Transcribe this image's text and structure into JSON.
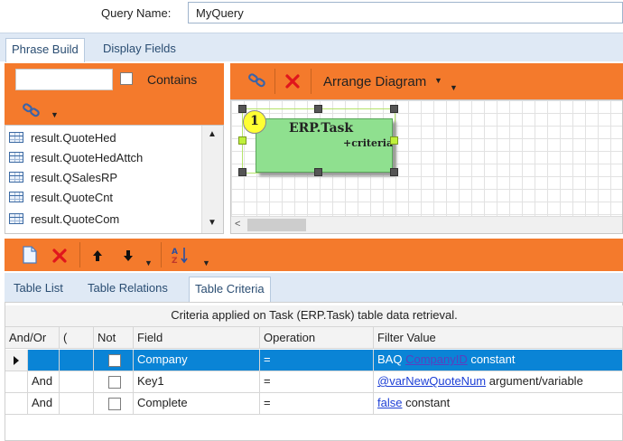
{
  "query": {
    "label": "Query Name:",
    "value": "MyQuery"
  },
  "top_tabs": [
    {
      "label": "Phrase Build",
      "active": true
    },
    {
      "label": "Display Fields",
      "active": false
    }
  ],
  "table_search": {
    "placeholder": "",
    "contains_label": "Contains"
  },
  "table_list": [
    "result.QuoteHed",
    "result.QuoteHedAttch",
    "result.QSalesRP",
    "result.QuoteCnt",
    "result.QuoteCom"
  ],
  "diagram": {
    "arrange_label": "Arrange Diagram",
    "node": {
      "number": "1",
      "title": "ERP.Task",
      "subtitle": "+criteria"
    }
  },
  "bottom_tabs": [
    {
      "label": "Table List",
      "active": false
    },
    {
      "label": "Table Relations",
      "active": false
    },
    {
      "label": "Table Criteria",
      "active": true
    }
  ],
  "criteria": {
    "caption": "Criteria applied on Task (ERP.Task)  table data retrieval.",
    "columns": [
      "And/Or",
      "(",
      "Not",
      "Field",
      "Operation",
      "Filter Value"
    ],
    "rows": [
      {
        "andor": "",
        "field": "Company",
        "operation": "=",
        "prefix": "BAQ ",
        "link": "CompanyID",
        "suffix": " constant",
        "selected": true
      },
      {
        "andor": "And",
        "field": "Key1",
        "operation": "=",
        "prefix": "",
        "link": "@varNewQuoteNum",
        "suffix": " argument/variable",
        "selected": false
      },
      {
        "andor": "And",
        "field": "Complete",
        "operation": "=",
        "prefix": "",
        "link": "false",
        "suffix": " constant",
        "selected": false
      }
    ]
  },
  "colors": {
    "toolbar_orange": "#f47a2c",
    "tab_strip": "#dfe9f5",
    "selection": "#0a84d6",
    "node_fill": "#8fe08f"
  }
}
